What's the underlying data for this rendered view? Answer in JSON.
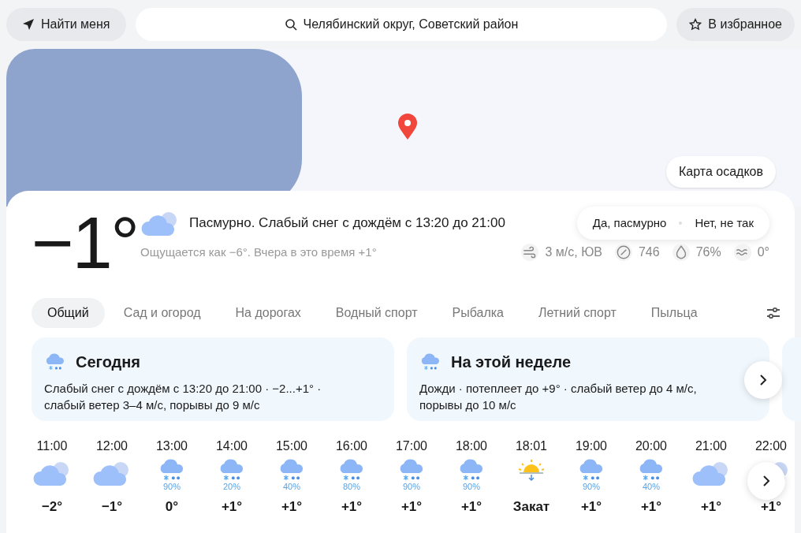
{
  "top_bar": {
    "locate_button": "Найти меня",
    "search": {
      "value": "Челябинский округ, Советский район"
    },
    "favorite_button": "В избранное"
  },
  "map": {
    "button": "Карта осадков"
  },
  "current": {
    "temperature": "−1°",
    "condition": "Пасмурно. Слабый снег с дождём с 13:20 до 21:00",
    "feels_like": "Ощущается как −6°. Вчера в это время +1°",
    "feedback": [
      "Да, пасмурно",
      "Нет, не так"
    ],
    "details": [
      {
        "kind": "wind",
        "text": "3 м/с, ЮВ"
      },
      {
        "kind": "pressure",
        "text": "746"
      },
      {
        "kind": "humidity",
        "text": "76%"
      },
      {
        "kind": "water",
        "text": "0°"
      }
    ]
  },
  "tabs": [
    {
      "label": "Общий",
      "selected": true
    },
    {
      "label": "Сад и огород",
      "selected": false
    },
    {
      "label": "На дорогах",
      "selected": false
    },
    {
      "label": "Водный спорт",
      "selected": false
    },
    {
      "label": "Рыбалка",
      "selected": false
    },
    {
      "label": "Летний спорт",
      "selected": false
    },
    {
      "label": "Пыльца",
      "selected": false
    }
  ],
  "summaries": [
    {
      "title": "Сегодня",
      "text": "Слабый снег с дождём с 13:20 до 21:00 · −2...+1° · слабый ветер 3–4 м/с, порывы до 9 м/с"
    },
    {
      "title": "На этой неделе",
      "text": "Дожди · потеплеет до +9° · слабый ветер до 4 м/с, порывы до 10 м/с"
    }
  ],
  "hourly": [
    {
      "time": "11:00",
      "kind": "cloudy",
      "temp": "−2°"
    },
    {
      "time": "12:00",
      "kind": "cloudy",
      "temp": "−1°"
    },
    {
      "time": "13:00",
      "kind": "sleet",
      "chance": "90%",
      "temp": "0°"
    },
    {
      "time": "14:00",
      "kind": "sleet",
      "chance": "20%",
      "temp": "+1°"
    },
    {
      "time": "15:00",
      "kind": "sleet",
      "chance": "40%",
      "temp": "+1°"
    },
    {
      "time": "16:00",
      "kind": "sleet",
      "chance": "80%",
      "temp": "+1°"
    },
    {
      "time": "17:00",
      "kind": "sleet",
      "chance": "90%",
      "temp": "+1°"
    },
    {
      "time": "18:00",
      "kind": "sleet",
      "chance": "90%",
      "temp": "+1°"
    },
    {
      "time": "18:01",
      "kind": "sunset",
      "temp": "Закат"
    },
    {
      "time": "19:00",
      "kind": "sleet",
      "chance": "90%",
      "temp": "+1°"
    },
    {
      "time": "20:00",
      "kind": "sleet",
      "chance": "40%",
      "temp": "+1°"
    },
    {
      "time": "21:00",
      "kind": "cloudy",
      "temp": "+1°"
    },
    {
      "time": "22:00",
      "kind": "cloudy",
      "temp": "+1°"
    }
  ]
}
